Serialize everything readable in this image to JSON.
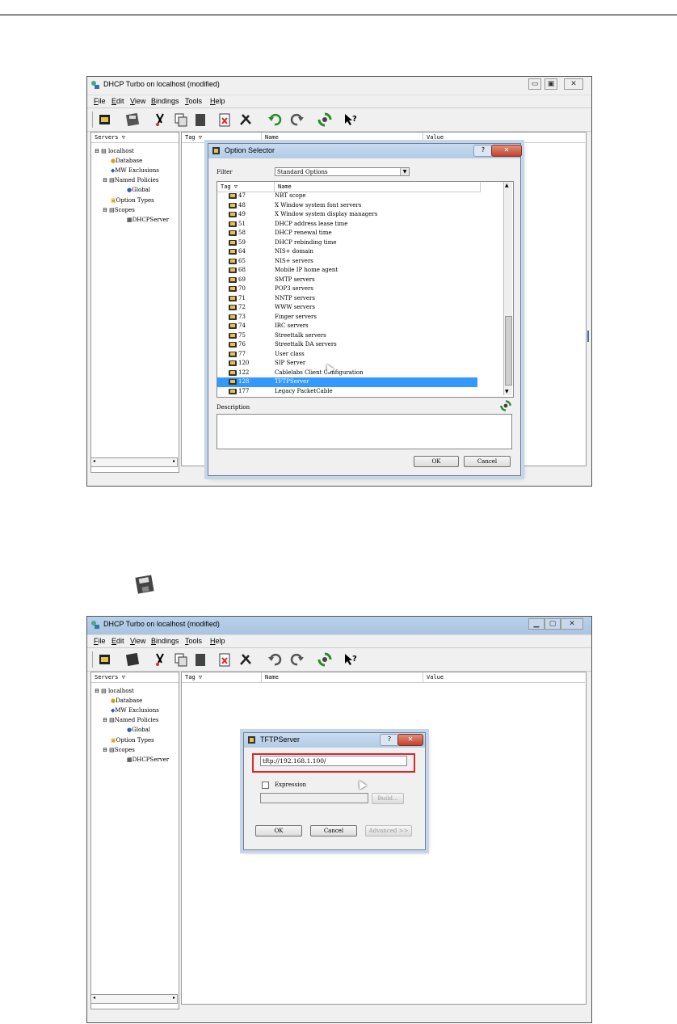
{
  "app": {
    "title": "DHCP Turbo on localhost (modified)"
  },
  "menu": [
    "File",
    "Edit",
    "View",
    "Bindings",
    "Tools",
    "Help"
  ],
  "tree": {
    "header": "Servers",
    "items": [
      "localhost",
      "Database",
      "MW Exclusions",
      "Named Policies",
      "Global",
      "Option Types",
      "Scopes",
      "DHCPServer"
    ]
  },
  "columns": {
    "tag": "Tag",
    "name": "Name",
    "value": "Value"
  },
  "option_selector": {
    "title": "Option Selector",
    "filter_label": "Filter",
    "filter_value": "Standard Options",
    "list_headers": {
      "tag": "Tag",
      "name": "Name"
    },
    "rows": [
      {
        "tag": "47",
        "name": "NBT scope"
      },
      {
        "tag": "48",
        "name": "X Window system font servers"
      },
      {
        "tag": "49",
        "name": "X Window system display managers"
      },
      {
        "tag": "51",
        "name": "DHCP address lease time"
      },
      {
        "tag": "58",
        "name": "DHCP renewal time"
      },
      {
        "tag": "59",
        "name": "DHCP rebinding time"
      },
      {
        "tag": "64",
        "name": "NIS+ domain"
      },
      {
        "tag": "65",
        "name": "NIS+ servers"
      },
      {
        "tag": "68",
        "name": "Mobile IP home agent"
      },
      {
        "tag": "69",
        "name": "SMTP servers"
      },
      {
        "tag": "70",
        "name": "POP3 servers"
      },
      {
        "tag": "71",
        "name": "NNTP servers"
      },
      {
        "tag": "72",
        "name": "WWW servers"
      },
      {
        "tag": "73",
        "name": "Finger servers"
      },
      {
        "tag": "74",
        "name": "IRC servers"
      },
      {
        "tag": "75",
        "name": "Streettalk servers"
      },
      {
        "tag": "76",
        "name": "Streettalk DA servers"
      },
      {
        "tag": "77",
        "name": "User class"
      },
      {
        "tag": "120",
        "name": "SIP Server"
      },
      {
        "tag": "122",
        "name": "Cablelabs Client Configuration"
      },
      {
        "tag": "128",
        "name": "TFTPServer"
      },
      {
        "tag": "177",
        "name": "Legacy PacketCable"
      }
    ],
    "selected_tag": "128",
    "description_label": "Description",
    "ok": "OK",
    "cancel": "Cancel"
  },
  "tftp_dialog": {
    "title": "TFTPServer",
    "value": "tftp://192.168.1.100/",
    "expression_label": "Expression",
    "build": "Build...",
    "ok": "OK",
    "cancel": "Cancel",
    "advanced": "Advanced >>"
  },
  "icons": [
    "save-icon",
    "help-pointer-icon",
    "refresh-icon",
    "undo-icon",
    "redo-icon",
    "delete-icon",
    "tools-icon",
    "copy-icon",
    "cut-icon",
    "folder-icon"
  ]
}
